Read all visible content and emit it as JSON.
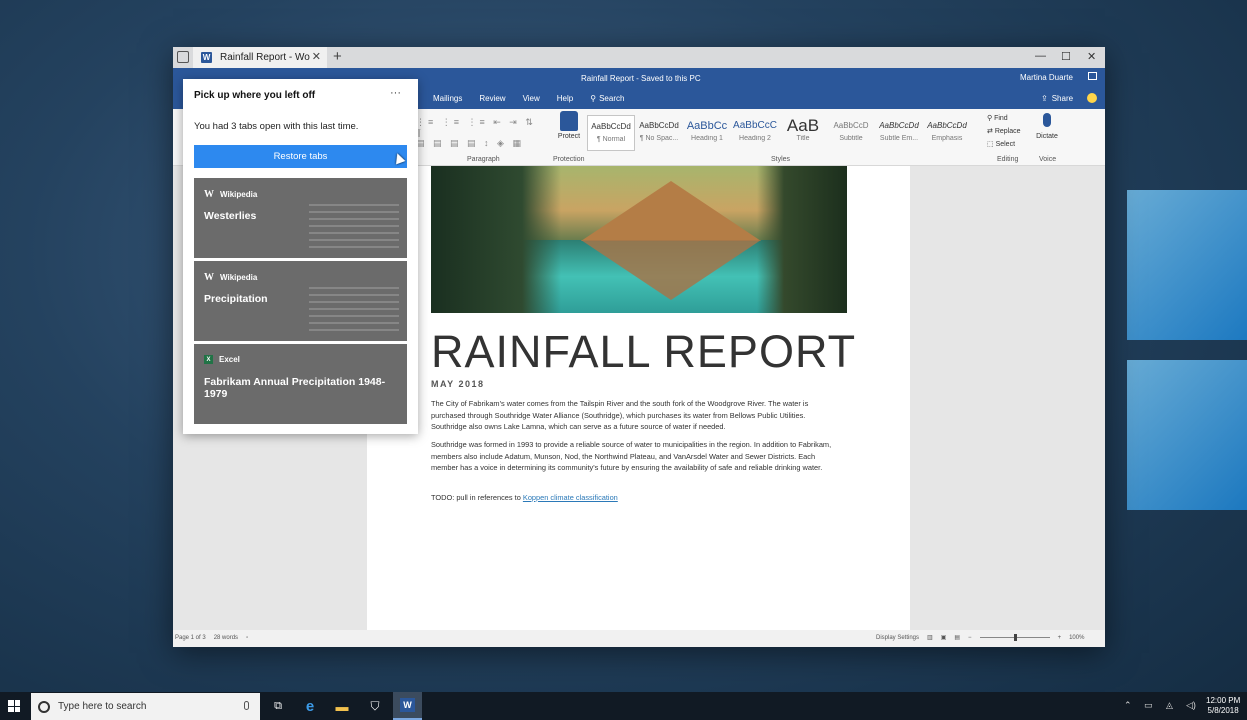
{
  "browser": {
    "tab_title": "Rainfall Report - Wo",
    "close_glyph": "✕",
    "new_tab_glyph": "+"
  },
  "window_controls": {
    "minimize": "—",
    "maximize": "☐",
    "close": "✕"
  },
  "word": {
    "doc_title": "Rainfall Report - Saved to this PC",
    "user_name": "Martina Duarte",
    "ribbon_tabs": [
      "Mailings",
      "Review",
      "View",
      "Help"
    ],
    "search_label": "Search",
    "share_label": "Share",
    "protect_label": "Protect",
    "styles": [
      {
        "preview": "AaBbCcDd",
        "name": "¶ Normal"
      },
      {
        "preview": "AaBbCcDd",
        "name": "¶ No Spac..."
      },
      {
        "preview": "AaBbCc",
        "name": "Heading 1"
      },
      {
        "preview": "AaBbCcC",
        "name": "Heading 2"
      },
      {
        "preview": "AaB",
        "name": "Title"
      },
      {
        "preview": "AaBbCcD",
        "name": "Subtitle"
      },
      {
        "preview": "AaBbCcDd",
        "name": "Subtle Em..."
      },
      {
        "preview": "AaBbCcDd",
        "name": "Emphasis"
      }
    ],
    "editing": {
      "find": "Find",
      "replace": "Replace",
      "select": "Select"
    },
    "dictate_label": "Dictate",
    "group_labels": {
      "paragraph": "Paragraph",
      "protection": "Protection",
      "styles": "Styles",
      "editing": "Editing",
      "voice": "Voice"
    }
  },
  "document": {
    "heading": "RAINFALL REPORT",
    "date": "MAY 2018",
    "para1": "The City of Fabrikam's water comes from the Tailspin River and the south fork of the Woodgrove River. The water is purchased through Southridge Water Alliance (Southridge), which purchases its water from Bellows Public Utilities. Southridge also owns Lake Lamna, which can serve as a future source of water if needed.",
    "para2": "Southridge was formed in 1993 to provide a reliable source of water to municipalities in the region. In addition to Fabrikam, members also include Adatum, Munson, Nod, the Northwind Plateau, and VanArsdel Water and Sewer Districts. Each member has a voice in determining its community's future by ensuring the availability of safe and reliable drinking water.",
    "todo_prefix": "TODO: pull in references to",
    "todo_link": "Koppen climate classification"
  },
  "status": {
    "page": "Page 1 of 3",
    "words": "28 words",
    "display_settings": "Display Settings",
    "zoom": "100%"
  },
  "popup": {
    "title": "Pick up where you left off",
    "more": "···",
    "message": "You had 3 tabs open with this last time.",
    "restore_label": "Restore tabs",
    "cards": [
      {
        "source": "Wikipedia",
        "title": "Westerlies"
      },
      {
        "source": "Wikipedia",
        "title": "Precipitation"
      },
      {
        "source": "Excel",
        "title": "Fabrikam Annual Precipitation 1948-1979"
      }
    ]
  },
  "taskbar": {
    "search_placeholder": "Type here to search",
    "time": "12:00 PM",
    "date": "5/8/2018"
  },
  "colors": {
    "word_blue": "#2b579a",
    "restore_blue": "#2d89ef",
    "link_blue": "#2b79b8"
  }
}
